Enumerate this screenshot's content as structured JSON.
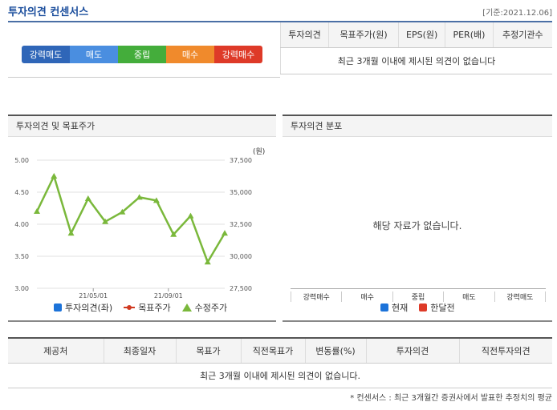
{
  "header": {
    "title": "투자의견 컨센서스",
    "date": "[기준:2021.12.06]"
  },
  "rec_scale": [
    {
      "label": "강력매도",
      "color": "#2f66b8"
    },
    {
      "label": "매도",
      "color": "#4a8ee0"
    },
    {
      "label": "중립",
      "color": "#44ad3b"
    },
    {
      "label": "매수",
      "color": "#f08a2c"
    },
    {
      "label": "강력매수",
      "color": "#de3a28"
    }
  ],
  "consensus_table": {
    "headers": [
      "투자의견",
      "목표주가(원)",
      "EPS(원)",
      "PER(배)",
      "추정기관수"
    ],
    "empty_message": "최근 3개월 이내에 제시된 의견이 없습니다"
  },
  "opinion_panel": {
    "title": "투자의견 및 목표주가",
    "unit": "(원)",
    "legend": [
      {
        "label": "투자의견(좌)",
        "color": "#1c73d9",
        "icon": "square-icon"
      },
      {
        "label": "목표주가",
        "color": "#d03a21",
        "icon": "dot-line-icon"
      },
      {
        "label": "수정주가",
        "color": "#7ab83b",
        "icon": "triangle-icon"
      }
    ]
  },
  "distribution_panel": {
    "title": "투자의견 분포",
    "empty_message": "해당 자료가 없습니다.",
    "categories": [
      "강력매수",
      "매수",
      "중립",
      "매도",
      "강력매도"
    ],
    "legend": [
      {
        "label": "현재",
        "color": "#1c73d9"
      },
      {
        "label": "한달전",
        "color": "#de3a28"
      }
    ]
  },
  "chart_data": {
    "type": "line",
    "x_ticks": [
      "21/05/01",
      "21/09/01"
    ],
    "left_axis": {
      "ticks": [
        "5.00",
        "4.50",
        "4.00",
        "3.50",
        "3.00"
      ],
      "range": [
        3.0,
        5.0
      ]
    },
    "right_axis": {
      "ticks": [
        "37,500",
        "35,000",
        "32,500",
        "30,000",
        "27,500"
      ],
      "range": [
        27500,
        37500
      ]
    },
    "series": [
      {
        "name": "수정주가",
        "color": "#7ab83b",
        "values": [
          33500,
          36250,
          31800,
          34500,
          32700,
          33450,
          34600,
          34350,
          31700,
          33150,
          29550,
          31800
        ]
      }
    ]
  },
  "detail_table": {
    "headers": [
      "제공처",
      "최종일자",
      "목표가",
      "직전목표가",
      "변동률(%)",
      "투자의견",
      "직전투자의견"
    ],
    "empty_message": "최근 3개월 이내에 제시된 의견이 없습니다."
  },
  "footnote": "* 컨센서스 : 최근 3개월간 증권사에서 발표한 추정치의 평균"
}
